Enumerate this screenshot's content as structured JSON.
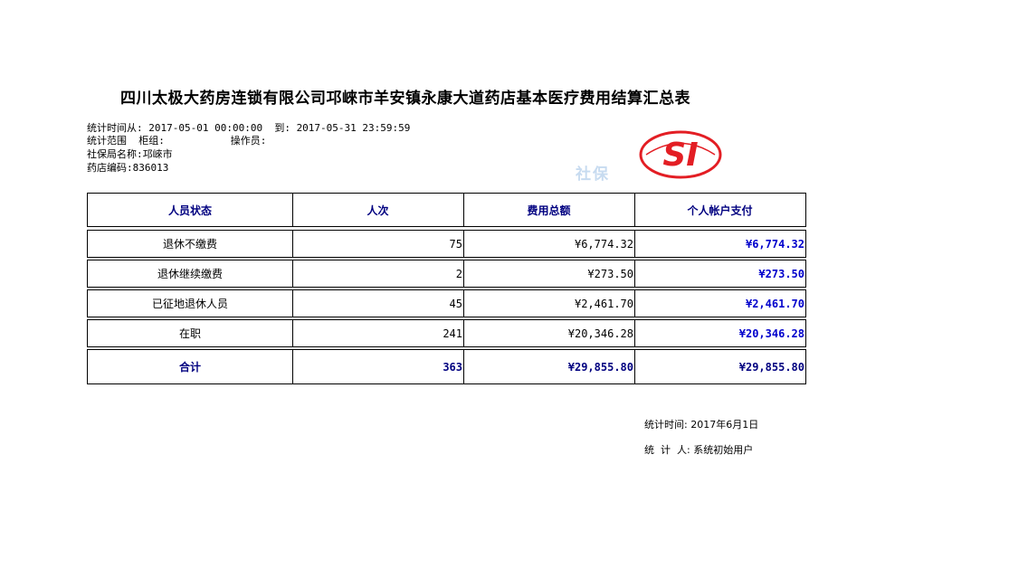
{
  "report": {
    "title": "四川太极大药房连锁有限公司邛崍市羊安镇永康大道药店基本医疗费用结算汇总表",
    "period": "统计时间从: 2017-05-01 00:00:00  到: 2017-05-31 23:59:59",
    "scope": "统计范围  柜组:           操作员:",
    "bureau": "社保局名称:邛崍市",
    "store_code": "药店编码:836013",
    "watermark": "社保",
    "logo_text": "SI"
  },
  "table": {
    "headers": [
      "人员状态",
      "人次",
      "费用总额",
      "个人帐户支付"
    ],
    "rows": [
      {
        "status": "退休不缴费",
        "count": "75",
        "total": "¥6,774.32",
        "personal": "¥6,774.32"
      },
      {
        "status": "退休继续缴费",
        "count": "2",
        "total": "¥273.50",
        "personal": "¥273.50"
      },
      {
        "status": "已征地退休人员",
        "count": "45",
        "total": "¥2,461.70",
        "personal": "¥2,461.70"
      },
      {
        "status": "在职",
        "count": "241",
        "total": "¥20,346.28",
        "personal": "¥20,346.28"
      }
    ],
    "sum": {
      "status": "合计",
      "count": "363",
      "total": "¥29,855.80",
      "personal": "¥29,855.80"
    }
  },
  "footer": {
    "stat_time": "统计时间: 2017年6月1日",
    "stat_person": "统  计  人: 系统初始用户"
  },
  "colors": {
    "header_text": "#000080",
    "personal_text": "#0000cc",
    "logo_red": "#e31e24"
  }
}
